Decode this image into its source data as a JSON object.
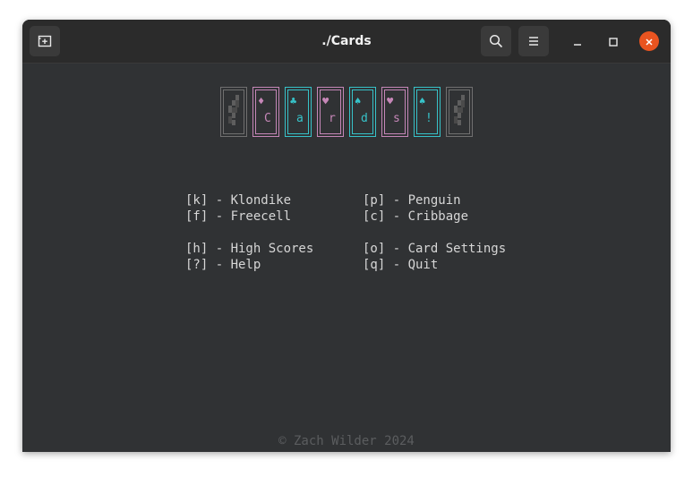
{
  "window": {
    "title": "./Cards"
  },
  "titlebar": {
    "new_tab_icon": "new-tab-icon",
    "search_icon": "search-icon",
    "menu_icon": "hamburger-menu-icon",
    "minimize_icon": "minimize-icon",
    "maximize_icon": "maximize-icon",
    "close_icon": "close-icon",
    "close_color": "#e95420"
  },
  "logo": {
    "cards": [
      {
        "type": "back"
      },
      {
        "suit": "♦",
        "letter": "C",
        "color": "pink"
      },
      {
        "suit": "♣",
        "letter": "a",
        "color": "cyan"
      },
      {
        "suit": "♥",
        "letter": "r",
        "color": "pink"
      },
      {
        "suit": "♠",
        "letter": "d",
        "color": "cyan"
      },
      {
        "suit": "♥",
        "letter": "s",
        "color": "pink"
      },
      {
        "suit": "♠",
        "letter": "!",
        "color": "cyan"
      },
      {
        "type": "back"
      }
    ],
    "colors": {
      "pink": "#c687b8",
      "cyan": "#37c3c9",
      "back": "#707070"
    }
  },
  "menu": {
    "klondike": "[k] - Klondike",
    "penguin": "[p] - Penguin",
    "freecell": "[f] - Freecell",
    "cribbage": "[c] - Cribbage",
    "high_scores": "[h] - High Scores",
    "card_settings": "[o] - Card Settings",
    "help": "[?] - Help",
    "quit": "[q] - Quit"
  },
  "footer": {
    "copyright": "© Zach Wilder 2024"
  }
}
